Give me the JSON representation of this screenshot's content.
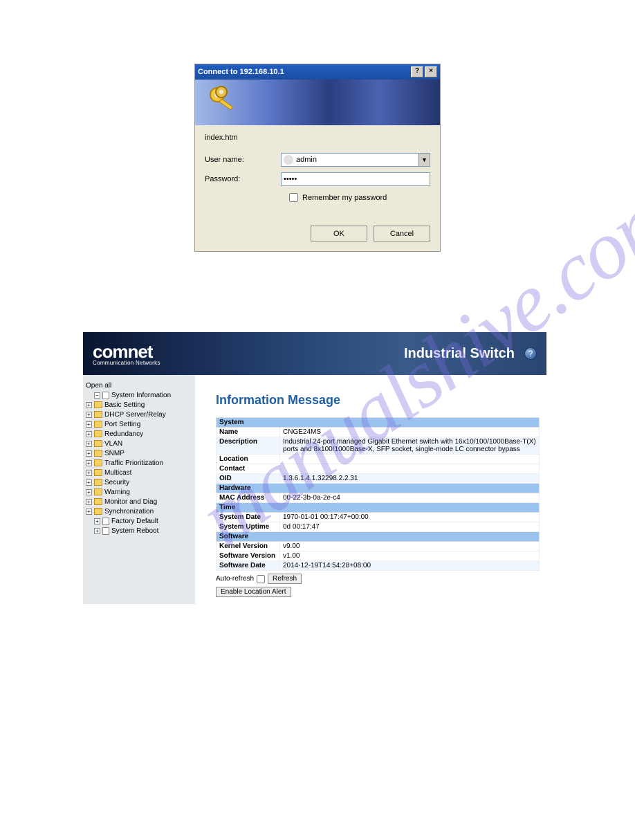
{
  "watermark": "manualshive.com",
  "dialog": {
    "title": "Connect to 192.168.10.1",
    "help_btn": "?",
    "close_btn": "×",
    "realm": "index.htm",
    "username_label": "User name:",
    "username_value": "admin",
    "password_label": "Password:",
    "password_value": "•••••",
    "remember_label": "Remember my password",
    "ok": "OK",
    "cancel": "Cancel"
  },
  "switch_ui": {
    "brand": "comnet",
    "brand_sub": "Communication Networks",
    "title": "Industrial Switch",
    "help": "?",
    "sidebar": {
      "open_all": "Open all",
      "items": [
        "System Information",
        "Basic Setting",
        "DHCP Server/Relay",
        "Port Setting",
        "Redundancy",
        "VLAN",
        "SNMP",
        "Traffic Prioritization",
        "Multicast",
        "Security",
        "Warning",
        "Monitor and Diag",
        "Synchronization",
        "Factory Default",
        "System Reboot"
      ]
    },
    "main": {
      "heading": "Information Message",
      "sections": {
        "system": {
          "header": "System",
          "rows": [
            {
              "k": "Name",
              "v": "CNGE24MS"
            },
            {
              "k": "Description",
              "v": "Industrial 24-port managed Gigabit Ethernet switch with 16x10/100/1000Base-T(X) ports and 8x100/1000Base-X, SFP socket, single-mode LC connector bypass"
            },
            {
              "k": "Location",
              "v": ""
            },
            {
              "k": "Contact",
              "v": ""
            },
            {
              "k": "OID",
              "v": "1.3.6.1.4.1.32298.2.2.31"
            }
          ]
        },
        "hardware": {
          "header": "Hardware",
          "rows": [
            {
              "k": "MAC Address",
              "v": "00-22-3b-0a-2e-c4"
            }
          ]
        },
        "time": {
          "header": "Time",
          "rows": [
            {
              "k": "System Date",
              "v": "1970-01-01 00:17:47+00:00"
            },
            {
              "k": "System Uptime",
              "v": "0d 00:17:47"
            }
          ]
        },
        "software": {
          "header": "Software",
          "rows": [
            {
              "k": "Kernel Version",
              "v": "v9.00"
            },
            {
              "k": "Software Version",
              "v": "v1.00"
            },
            {
              "k": "Software Date",
              "v": "2014-12-19T14:54:28+08:00"
            }
          ]
        }
      },
      "auto_refresh": "Auto-refresh",
      "refresh_btn": "Refresh",
      "location_btn": "Enable Location Alert"
    }
  }
}
